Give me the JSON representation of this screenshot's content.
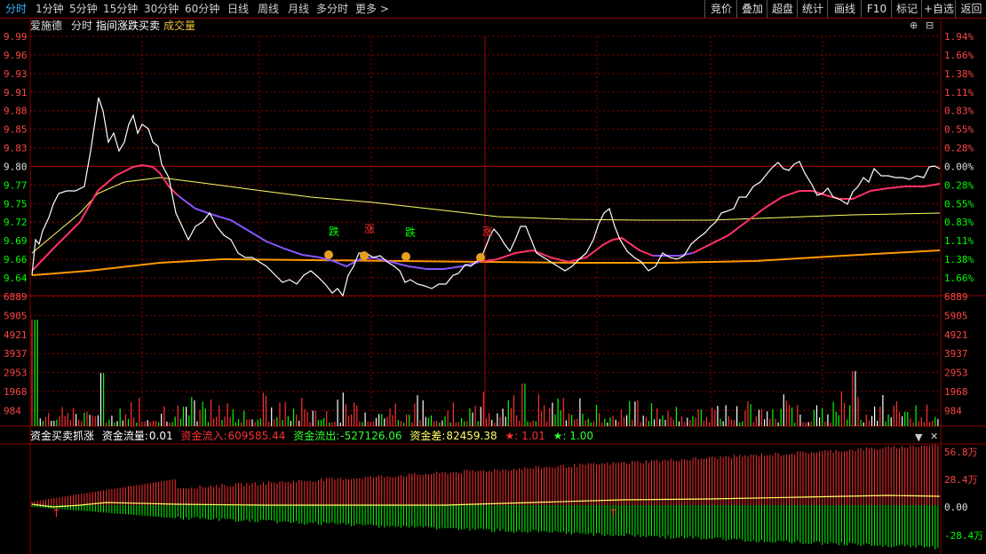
{
  "tabs": [
    "分时",
    "1分钟",
    "5分钟",
    "15分钟",
    "30分钟",
    "60分钟",
    "日线",
    "周线",
    "月线",
    "多分时",
    "更多 >"
  ],
  "right_buttons": [
    "竞价",
    "叠加",
    "超盘",
    "统计",
    "画线",
    "F10",
    "标记",
    "+自选",
    "返回"
  ],
  "info": {
    "name": "爱施德",
    "mode": "分时",
    "indicator": "指间涨跌买卖",
    "volume": "成交量"
  },
  "price_labels": [
    "9.99",
    "9.96",
    "9.93",
    "9.91",
    "9.88",
    "9.85",
    "9.83",
    "9.80",
    "9.77",
    "9.75",
    "9.72",
    "9.69",
    "9.66",
    "9.64"
  ],
  "pct_labels": [
    "1.94%",
    "1.66%",
    "1.38%",
    "1.11%",
    "0.83%",
    "0.55%",
    "0.28%",
    "0.00%",
    "0.28%",
    "0.55%",
    "0.83%",
    "1.11%",
    "1.38%",
    "1.66%"
  ],
  "vol_labels": [
    "6889",
    "5905",
    "4921",
    "3937",
    "2953",
    "1968",
    "984"
  ],
  "signals": [
    {
      "text": "跌",
      "color": "#00ff00"
    },
    {
      "text": "涨",
      "color": "#ff3030"
    },
    {
      "text": "跌",
      "color": "#00ff00"
    },
    {
      "text": "涨",
      "color": "#ff3030"
    }
  ],
  "fund": {
    "title": "资金买卖抓涨",
    "flow_label": "资金流量:",
    "flow_value": "0.01",
    "in_label": "资金流入:",
    "in_value": "609585.44",
    "out_label": "资金流出:",
    "out_value": "-527126.06",
    "diff_label": "资金差:",
    "diff_value": "82459.38",
    "star_red": "★: 1.01",
    "star_green": "★: 1.00",
    "axis": [
      "56.8万",
      "28.4万",
      "0.00",
      "-28.4万"
    ]
  },
  "colors": {
    "up": "#ff3030",
    "down": "#00ff00",
    "grid": "#8b0000",
    "price": "#ffffff",
    "avg": "#ffff66",
    "ma_orange": "#ff9900",
    "pink": "#ff3366",
    "purple": "#8855ff",
    "axis_red": "#ff4444"
  }
}
